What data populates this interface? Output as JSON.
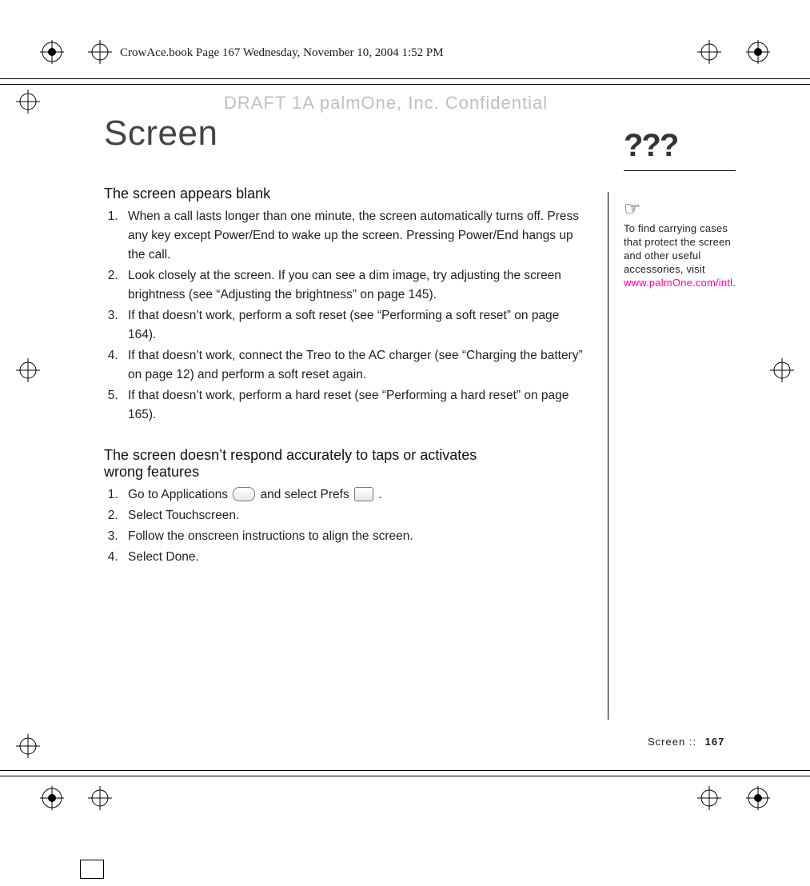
{
  "running_header": "CrowAce.book  Page 167  Wednesday, November 10, 2004  1:52 PM",
  "watermark": "DRAFT 1A  palmOne, Inc.   Confidential",
  "section_title": "Screen",
  "subhead1": "The screen appears blank",
  "steps1": [
    "When a call lasts longer than one minute, the screen automatically turns off. Press any key except Power/End to wake up the screen. Pressing Power/End hangs up the call.",
    "Look closely at the screen. If you can see a dim image, try adjusting the screen brightness (see “Adjusting the brightness” on page 145).",
    "If that doesn’t work, perform a soft reset (see “Performing a soft reset” on page 164).",
    "If that doesn’t work, connect the Treo to the AC charger (see “Charging the battery” on page 12) and perform a soft reset again.",
    "If that doesn’t work, perform a hard reset (see “Performing a hard reset” on page 165)."
  ],
  "subhead2": "The screen doesn’t respond accurately to taps or activates wrong features",
  "step2_1_a": "Go to Applications ",
  "step2_1_b": " and select Prefs ",
  "step2_1_c": ".",
  "steps2_rest": [
    "Select Touchscreen.",
    "Follow the onscreen instructions to align the screen.",
    "Select Done."
  ],
  "qmark": "???",
  "tip_lead": "To find carrying cases that protect the screen and other useful accessories, visit ",
  "tip_link": "www.palmOne.com/intl",
  "tip_tail": ".",
  "footer_label": "Screen   ::",
  "footer_page": "167"
}
